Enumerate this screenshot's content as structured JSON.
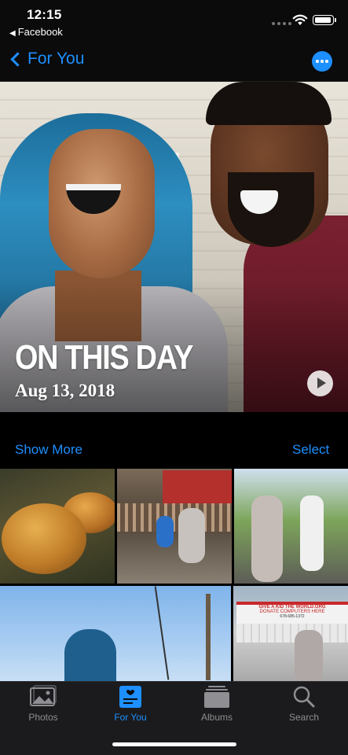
{
  "status_bar": {
    "time": "12:15",
    "back_app": "Facebook"
  },
  "nav": {
    "back_label": "For You",
    "accent_color": "#1e8fff"
  },
  "memory": {
    "title": "ON THIS DAY",
    "date": "Aug 13, 2018"
  },
  "actions": {
    "show_more": "Show More",
    "select": "Select"
  },
  "tab_bar": {
    "tabs": [
      {
        "label": "Photos",
        "icon": "photos-icon",
        "active": false
      },
      {
        "label": "For You",
        "icon": "for-you-icon",
        "active": true
      },
      {
        "label": "Albums",
        "icon": "albums-icon",
        "active": false
      },
      {
        "label": "Search",
        "icon": "search-icon",
        "active": false
      }
    ]
  },
  "photo_grid": {
    "text": {
      "sign_top": "GIVE A KID THE WORLD.ORG",
      "sign_mid": "DONATE COMPUTERS HERE",
      "sign_phone": "678-685-1372"
    }
  }
}
